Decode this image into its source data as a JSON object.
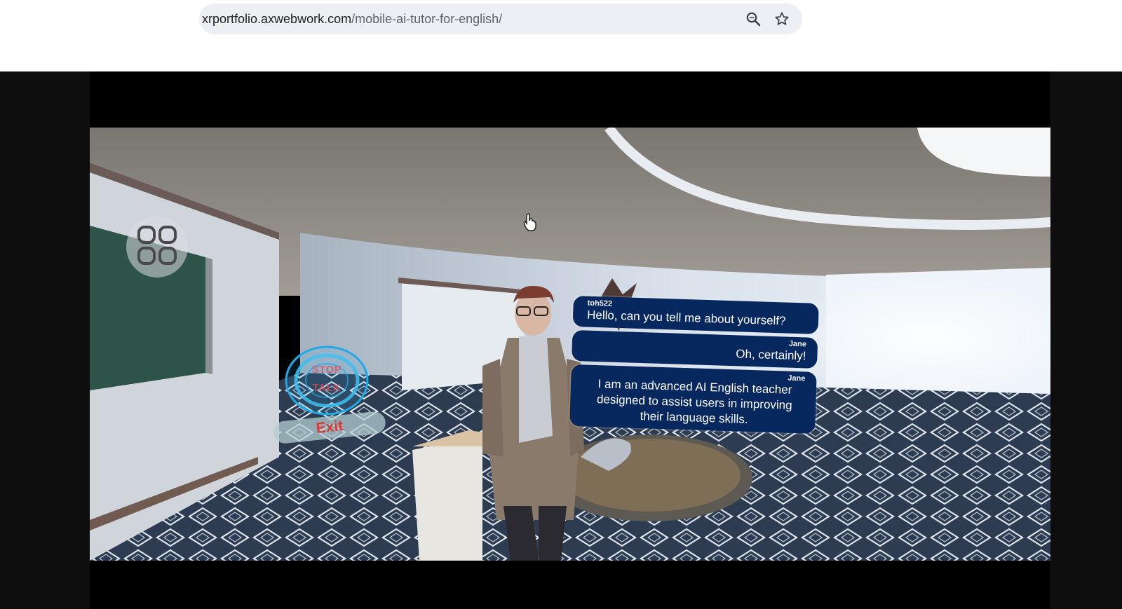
{
  "browser": {
    "url_host": "xrportfolio.axwebwork.com",
    "url_path": "/mobile-ai-tutor-for-english/",
    "icons": [
      "search-zoom-icon",
      "bookmark-star-icon"
    ]
  },
  "game": {
    "menu_icon": "grid-four-icon",
    "talk_button": {
      "line1": "STOP",
      "line2": "TALK"
    },
    "exit_button": "Exit",
    "chat": [
      {
        "speaker": "toh522",
        "text": "Hello, can you tell me about yourself?"
      },
      {
        "speaker": "Jane",
        "text": "Oh, certainly!"
      },
      {
        "speaker": "Jane",
        "text": "I am an advanced AI English teacher designed to assist users in improving their language skills."
      }
    ]
  },
  "colors": {
    "bubble": "#07285f",
    "exit_text": "#d83a3a",
    "talk_ring": "#1fa9e6"
  }
}
